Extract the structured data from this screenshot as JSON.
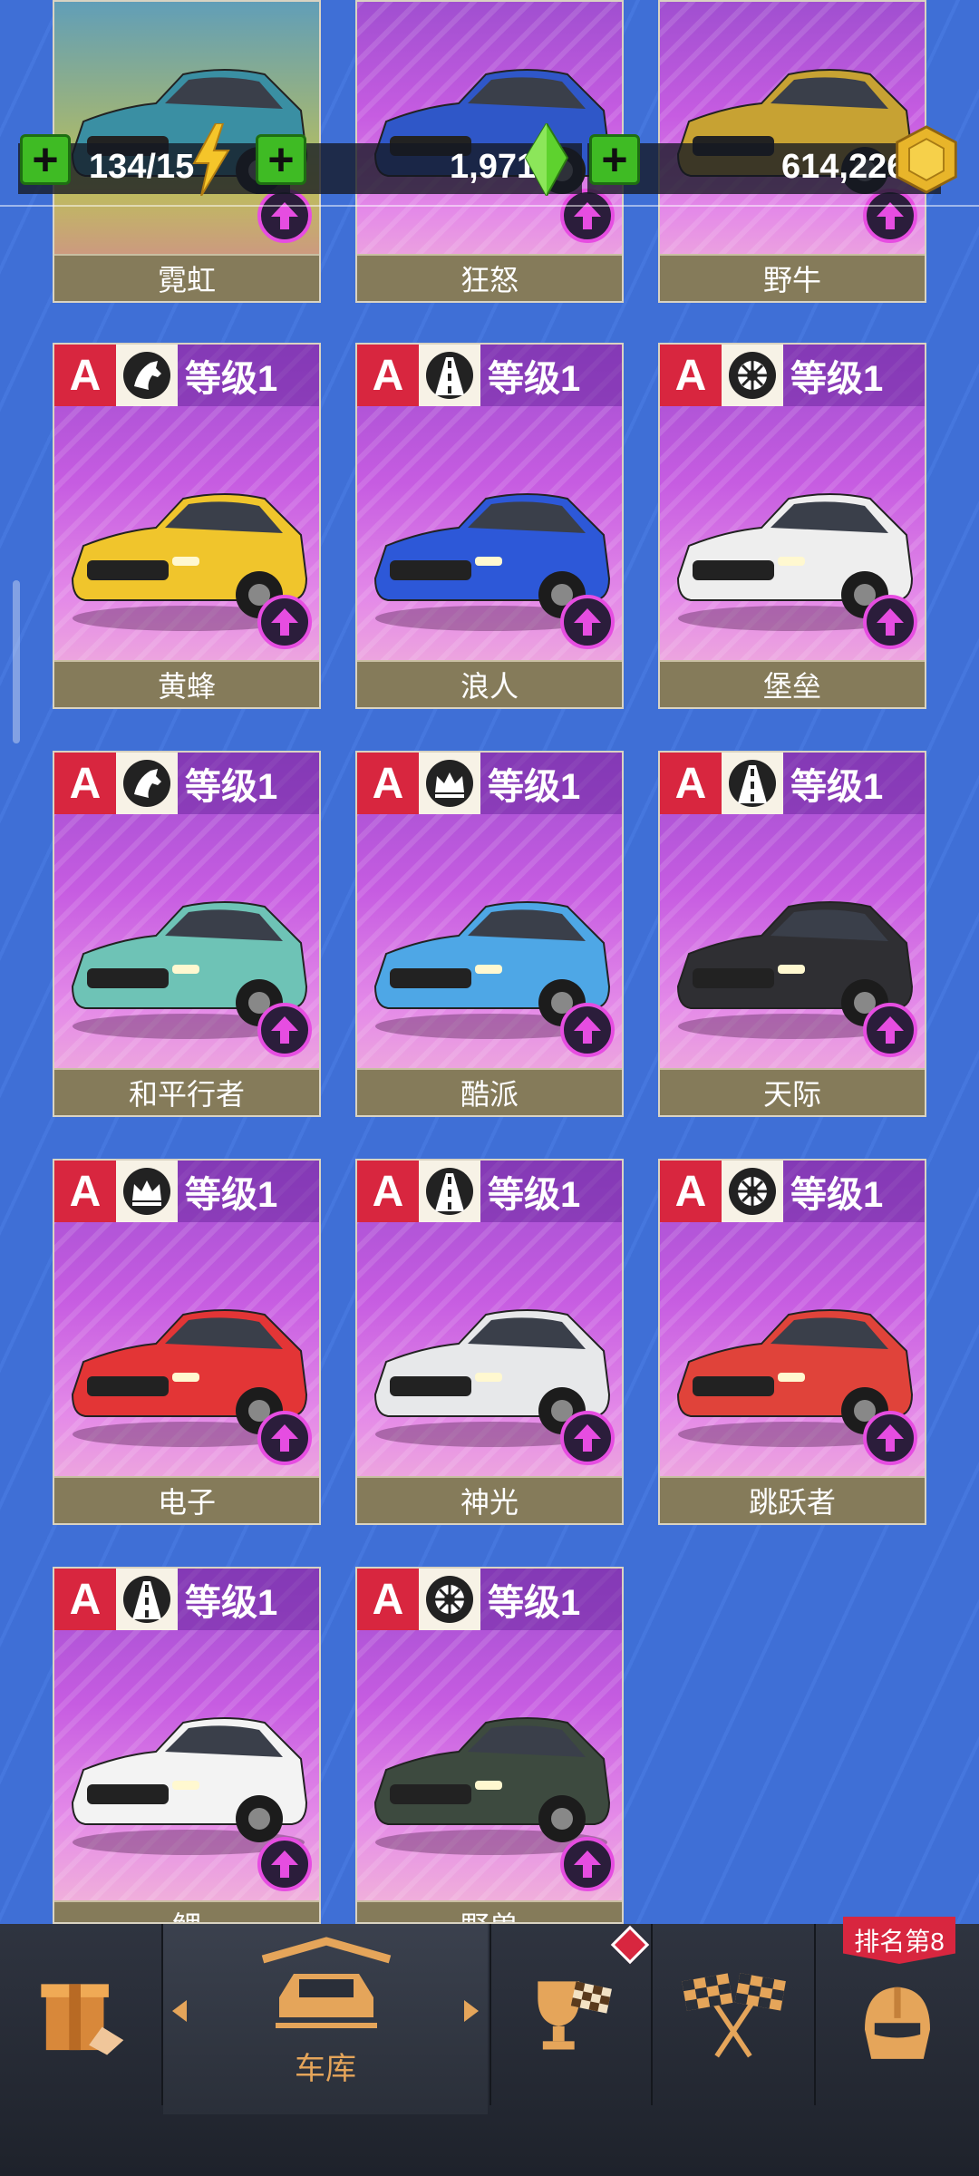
{
  "currency": {
    "energy": {
      "value": "134/15"
    },
    "gems": {
      "value": "1,971"
    },
    "coins": {
      "value": "614,226"
    }
  },
  "cards_row0": [
    {
      "name": "霓虹",
      "body_color": "#3a8fa3"
    },
    {
      "name": "狂怒",
      "body_color": "#2f57c8"
    },
    {
      "name": "野牛",
      "body_color": "#c7a233"
    }
  ],
  "cards": [
    {
      "rank": "A",
      "class_icon": "horse-icon",
      "level": "等级1",
      "name": "黄蜂",
      "body_color": "#f0c52c"
    },
    {
      "rank": "A",
      "class_icon": "road-icon",
      "level": "等级1",
      "name": "浪人",
      "body_color": "#2d58d8"
    },
    {
      "rank": "A",
      "class_icon": "tire-icon",
      "level": "等级1",
      "name": "堡垒",
      "body_color": "#eeeeee"
    },
    {
      "rank": "A",
      "class_icon": "horse-icon",
      "level": "等级1",
      "name": "和平行者",
      "body_color": "#6ec3b6"
    },
    {
      "rank": "A",
      "class_icon": "crown-icon",
      "level": "等级1",
      "name": "酷派",
      "body_color": "#4ea7e6"
    },
    {
      "rank": "A",
      "class_icon": "road-icon",
      "level": "等级1",
      "name": "天际",
      "body_color": "#2f2f33"
    },
    {
      "rank": "A",
      "class_icon": "crown-icon",
      "level": "等级1",
      "name": "电子",
      "body_color": "#e33536"
    },
    {
      "rank": "A",
      "class_icon": "road-icon",
      "level": "等级1",
      "name": "神光",
      "body_color": "#e7e8ea"
    },
    {
      "rank": "A",
      "class_icon": "tire-icon",
      "level": "等级1",
      "name": "跳跃者",
      "body_color": "#e0433a"
    },
    {
      "rank": "A",
      "class_icon": "road-icon",
      "level": "等级1",
      "name": "鲤",
      "body_color": "#f3f3f3"
    },
    {
      "rank": "A",
      "class_icon": "tire-icon",
      "level": "等级1",
      "name": "野兽",
      "body_color": "#3d4a3f"
    }
  ],
  "nav": {
    "garage_label": "车库",
    "rank_badge": "排名第8"
  },
  "colors": {
    "accent": "#e5a55a",
    "rank_red": "#d8263f",
    "plus_green": "#3fbb24",
    "upgrade_magenta": "#e64de1"
  }
}
